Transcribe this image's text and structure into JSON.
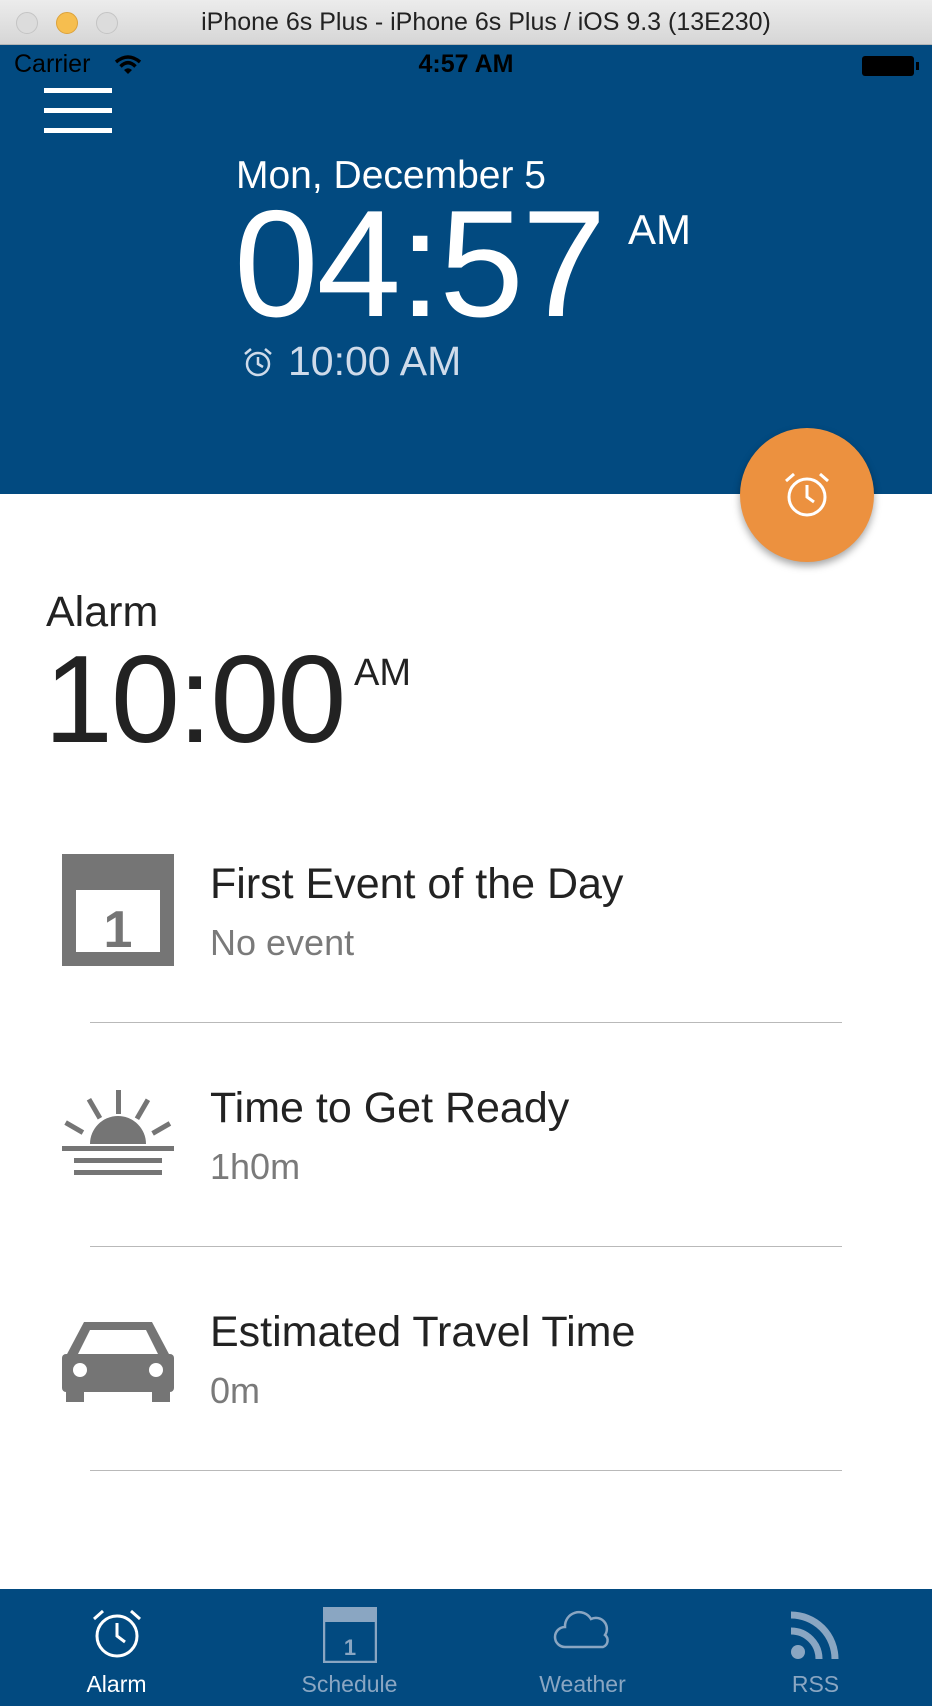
{
  "window": {
    "title": "iPhone 6s Plus - iPhone 6s Plus / iOS 9.3 (13E230)"
  },
  "status_bar": {
    "carrier": "Carrier",
    "time": "4:57 AM"
  },
  "header": {
    "date": "Mon, December 5",
    "time": "04:57",
    "ampm": "AM",
    "next_alarm": "10:00 AM"
  },
  "alarm": {
    "label": "Alarm",
    "time": "10:00",
    "ampm": "AM"
  },
  "rows": [
    {
      "title": "First Event of the Day",
      "subtitle": "No event",
      "icon": "calendar-icon"
    },
    {
      "title": "Time to Get Ready",
      "subtitle": "1h0m",
      "icon": "sunrise-icon"
    },
    {
      "title": "Estimated Travel Time",
      "subtitle": "0m",
      "icon": "car-icon"
    }
  ],
  "tabs": [
    {
      "label": "Alarm",
      "icon": "alarm-clock-icon",
      "active": true
    },
    {
      "label": "Schedule",
      "icon": "calendar-icon",
      "active": false
    },
    {
      "label": "Weather",
      "icon": "cloud-icon",
      "active": false
    },
    {
      "label": "RSS",
      "icon": "rss-icon",
      "active": false
    }
  ],
  "calendar_day": "1",
  "colors": {
    "header_bg": "#024a80",
    "fab": "#ec913f",
    "tab_active": "#ffffff",
    "tab_inactive": "#8aa6c2",
    "icon_gray": "#757575"
  }
}
